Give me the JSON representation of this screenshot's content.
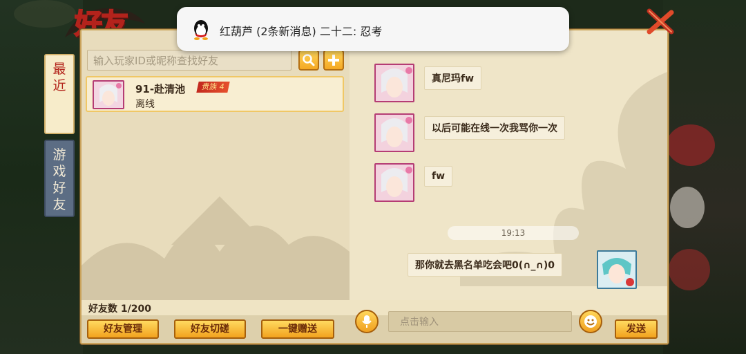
{
  "window": {
    "title": "好友"
  },
  "notification": {
    "app_icon": "qq-penguin-icon",
    "text": "红葫芦 (2条新消息) 二十二: 忍考"
  },
  "tabs": [
    {
      "label": "最\n近",
      "active": true
    },
    {
      "label": "游\n戏\n好\n友",
      "active": false
    }
  ],
  "search": {
    "placeholder": "输入玩家ID或昵称查找好友"
  },
  "friends": [
    {
      "name": "91-赴清池",
      "vip": "贵族 4",
      "status": "离线"
    }
  ],
  "friend_count": "好友数 1/200",
  "buttons": {
    "manage": "好友管理",
    "spar": "好友切磋",
    "gift": "一键赠送",
    "send": "发送"
  },
  "chat": {
    "messages": [
      {
        "from": "friend",
        "text": "真尼玛fw"
      },
      {
        "from": "friend",
        "text": "以后可能在线一次我骂你一次"
      },
      {
        "from": "friend",
        "text": "fw"
      },
      {
        "from": "self",
        "text": "那你就去黑名单吃会吧0(∩_∩)0"
      }
    ],
    "timestamp": "19:13",
    "input_placeholder": "点击输入"
  },
  "colors": {
    "accent_gold": "#f4a722",
    "title_red": "#b3231c",
    "avatar_border": "#b53c74"
  }
}
